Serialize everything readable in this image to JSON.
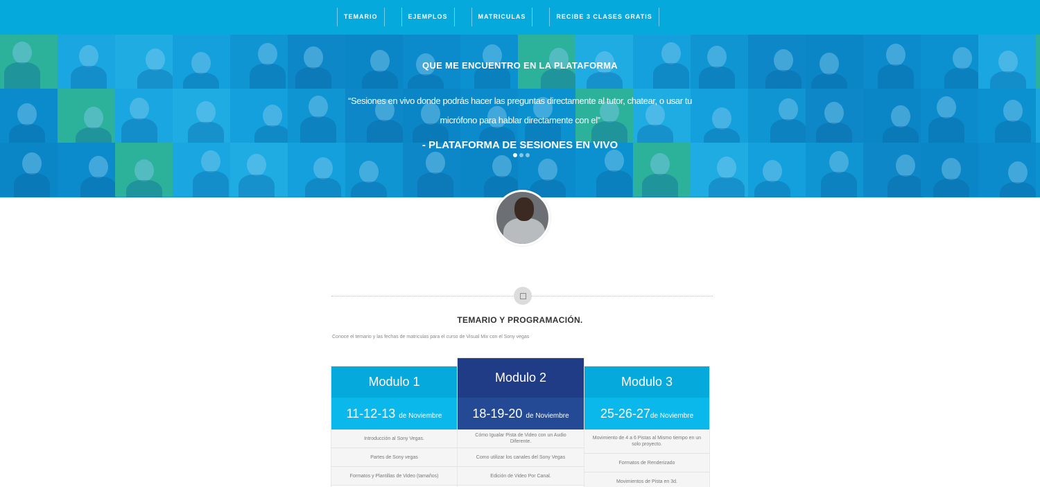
{
  "nav": {
    "items": [
      {
        "label": "TEMARIO"
      },
      {
        "label": "EJEMPLOS"
      },
      {
        "label": "MATRICULAS"
      },
      {
        "label": "RECIBE 3 CLASES GRATIS"
      }
    ]
  },
  "hero": {
    "heading": "QUE ME ENCUENTRO EN LA PLATAFORMA",
    "quote": "“Sesiones en vivo donde podrás hacer las preguntas directamente al tutor, chatear, o usar tu micrófono para hablar directamente con el”",
    "author": "- PLATAFORMA DE SESIONES EN VIVO",
    "slide_count": 3,
    "active_slide": 1
  },
  "section": {
    "title": "TEMARIO Y PROGRAMACIÓN.",
    "subtitle": "Conoce el temario y las fechas de matriculas para el curso de Visual Mix con el Sony vegas"
  },
  "modules": [
    {
      "title": "Modulo 1",
      "date_main": "11-12-13",
      "date_suffix": "de Noviembre",
      "items": [
        "Introducción al Sony Vegas.",
        "Partes de Sony vegas",
        "Formatos y Plantillas de Video (tamaños)"
      ]
    },
    {
      "title": "Modulo 2",
      "date_main": "18-19-20",
      "date_suffix": "de Noviembre",
      "items": [
        "Cómo Igualar Pista de Video con un Audio Diferente.",
        "Como utilizar los canales del Sony Vegas",
        "Edición de Video Por Canal."
      ]
    },
    {
      "title": "Modulo 3",
      "date_main": "25-26-27",
      "date_suffix": "de Noviembre",
      "items": [
        "Movimiento de 4 a 6 Pistas al Mismo tiempo en un solo proyecto.",
        "Formatos de Renderizado",
        "Movimientos de Pista en 3d."
      ]
    }
  ],
  "colors": {
    "nav_bg": "#05a9dc",
    "module_head": "#05a9dc",
    "module_date": "#0bb8ec",
    "featured_head": "#203c86",
    "featured_date": "#244a96"
  }
}
